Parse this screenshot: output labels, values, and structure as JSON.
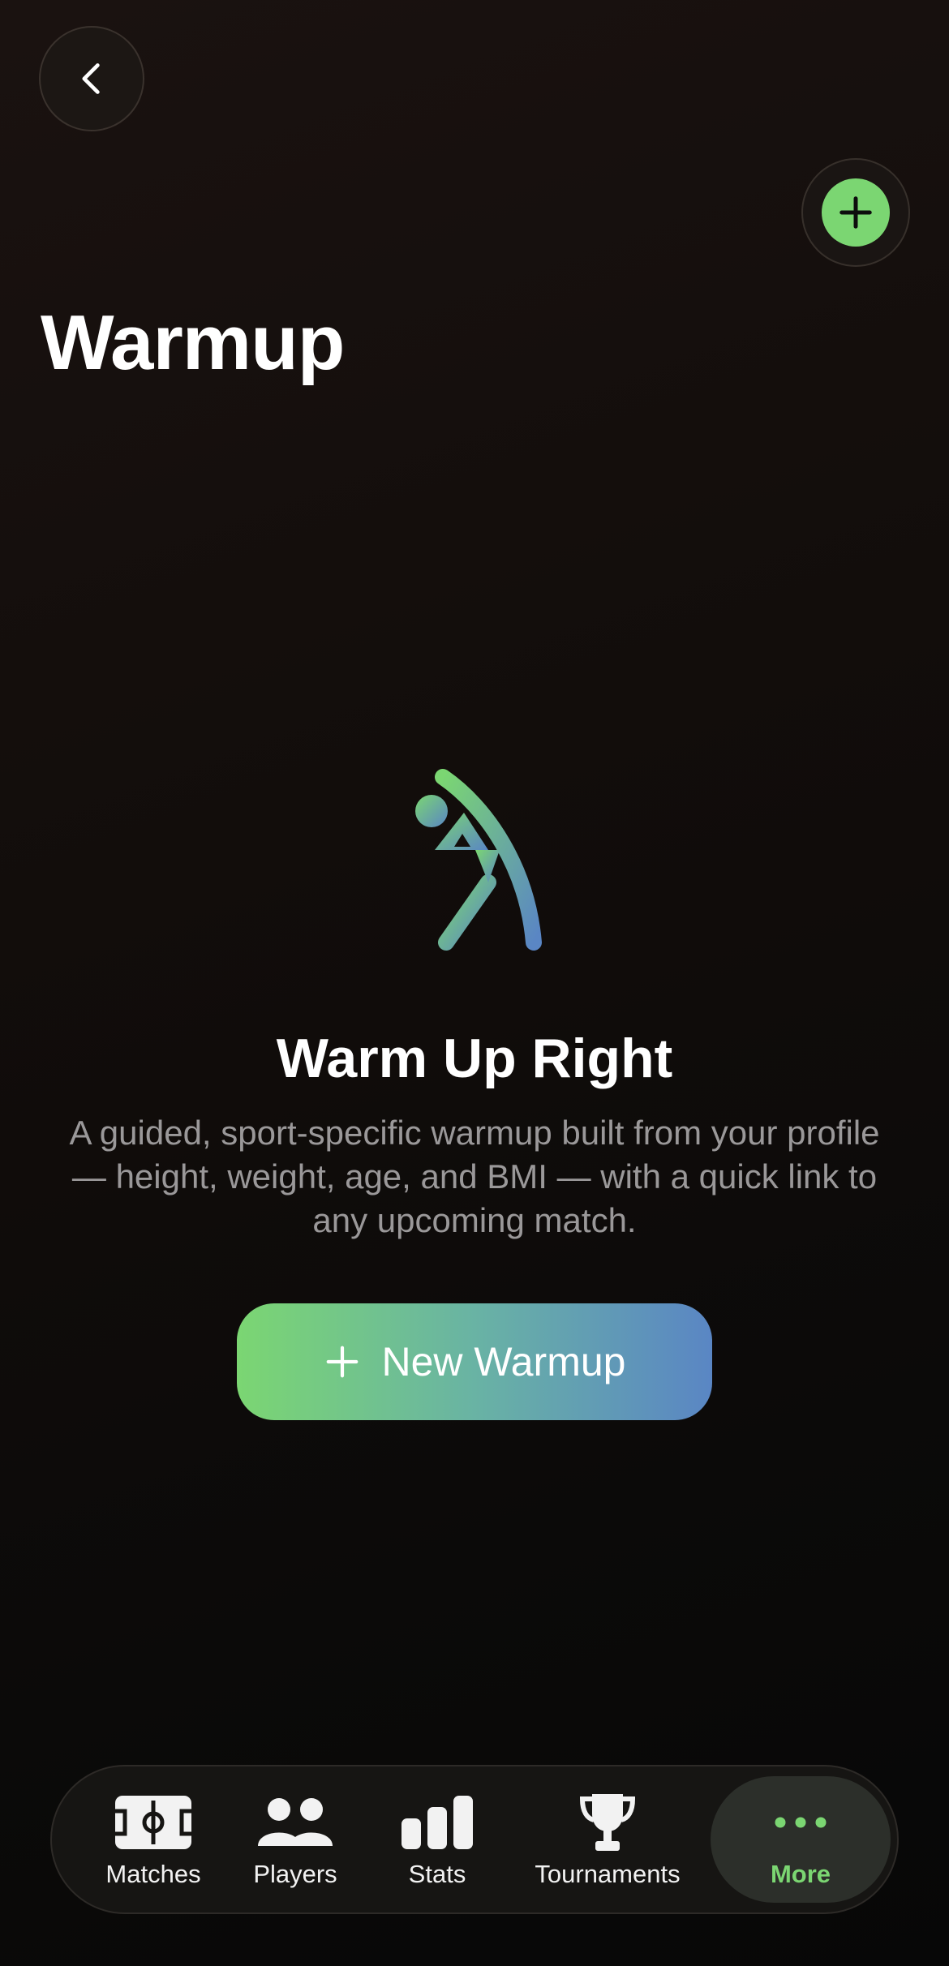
{
  "header": {
    "title": "Warmup"
  },
  "empty_state": {
    "title": "Warm Up Right",
    "description": "A guided, sport-specific warmup built from your profile — height, weight, age, and BMI — with a quick link to any upcoming match.",
    "button_label": "New Warmup"
  },
  "tab_bar": {
    "items": [
      {
        "label": "Matches",
        "icon": "soccer-field-icon",
        "active": false
      },
      {
        "label": "Players",
        "icon": "people-icon",
        "active": false
      },
      {
        "label": "Stats",
        "icon": "bar-chart-icon",
        "active": false
      },
      {
        "label": "Tournaments",
        "icon": "trophy-icon",
        "active": false
      },
      {
        "label": "More",
        "icon": "ellipsis-icon",
        "active": true
      }
    ]
  },
  "colors": {
    "accent_green": "#7bd672",
    "accent_blue": "#5a86c4",
    "description_gray": "#9a9899",
    "tab_active_text": "#7bd672",
    "tab_inactive_text": "#f2f2f2"
  }
}
